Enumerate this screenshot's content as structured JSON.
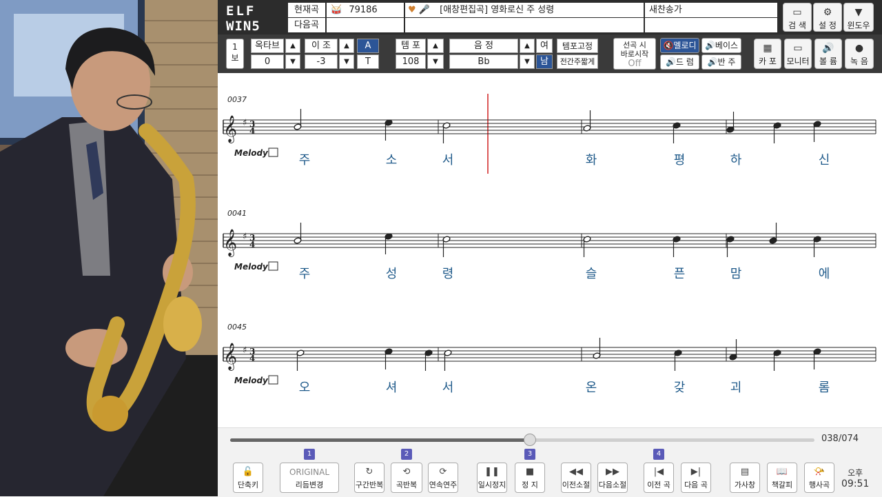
{
  "app": {
    "logo": "ELF WIN5",
    "current_song_label": "현재곡",
    "next_song_label": "다음곡",
    "song_number": "79186",
    "song_title": "[애창편집곡] 영화로신 주 성령",
    "category": "새찬송가",
    "top_buttons": [
      {
        "label": "검 색",
        "icon": "search-icon"
      },
      {
        "label": "설 정",
        "icon": "gear-icon"
      },
      {
        "label": "윈도우",
        "icon": "window-down-icon"
      }
    ]
  },
  "toolbar": {
    "view_label_top": "1",
    "view_label_bottom": "보",
    "octave_label": "옥타브",
    "octave_value": "0",
    "transpose_label": "이 조",
    "transpose_value": "-3",
    "accidental_top": "A",
    "accidental_bottom": "T",
    "tempo_label": "템 포",
    "tempo_value": "108",
    "key_label": "음 정",
    "key_value": "Bb",
    "female_label": "여",
    "male_label": "남",
    "tempo_fix_label": "템포고정",
    "prelude_short_label": "전간주짧게",
    "instant_start_line1": "선곡 시",
    "instant_start_line2": "바로시작",
    "instant_start_value": "Off",
    "melody_label": "멜로디",
    "bass_label": "베이스",
    "drum_label": "드 럼",
    "accomp_label": "반 주",
    "right_buttons": [
      {
        "label": "카 포",
        "icon": "capo-icon"
      },
      {
        "label": "모니터",
        "icon": "monitor-icon"
      },
      {
        "label": "볼 륨",
        "icon": "volume-icon"
      },
      {
        "label": "녹 음",
        "icon": "record-icon"
      }
    ]
  },
  "score": {
    "systems": [
      {
        "measure": "0037",
        "label": "Melody",
        "lyrics": [
          "주",
          "소",
          "서",
          "화",
          "평",
          "하",
          "신"
        ]
      },
      {
        "measure": "0041",
        "label": "Melody",
        "lyrics": [
          "주",
          "성",
          "령",
          "슬",
          "픈",
          "맘",
          "에"
        ]
      },
      {
        "measure": "0045",
        "label": "Melody",
        "lyrics": [
          "오",
          "셔",
          "서",
          "온",
          "갖",
          "괴",
          "롬"
        ]
      }
    ]
  },
  "player": {
    "progress_current": 38,
    "progress_total": 74,
    "counter_text": "038/074",
    "buttons": [
      {
        "label": "단축키",
        "icon": "lock-icon",
        "badge": ""
      },
      {
        "label": "리듬변경",
        "icon": "original-icon",
        "top": "ORIGINAL",
        "badge": "1"
      },
      {
        "label": "구간반복",
        "icon": "section-repeat-icon",
        "badge": ""
      },
      {
        "label": "곡반복",
        "icon": "song-repeat-icon",
        "badge": "2"
      },
      {
        "label": "연속연주",
        "icon": "continuous-play-icon",
        "badge": ""
      },
      {
        "label": "일시정지",
        "icon": "pause-icon",
        "badge": ""
      },
      {
        "label": "정 지",
        "icon": "stop-icon",
        "badge": "3"
      },
      {
        "label": "이전소절",
        "icon": "rewind-icon",
        "badge": ""
      },
      {
        "label": "다음소절",
        "icon": "fast-forward-icon",
        "badge": ""
      },
      {
        "label": "이전 곡",
        "icon": "previous-track-icon",
        "badge": "4"
      },
      {
        "label": "다음 곡",
        "icon": "next-track-icon",
        "badge": ""
      },
      {
        "label": "가사창",
        "icon": "lyrics-window-icon",
        "badge": ""
      },
      {
        "label": "책갈피",
        "icon": "bookmark-icon",
        "badge": ""
      },
      {
        "label": "행사곡",
        "icon": "event-song-icon",
        "badge": ""
      }
    ],
    "clock_ampm": "오후",
    "clock_time": "09:51"
  }
}
